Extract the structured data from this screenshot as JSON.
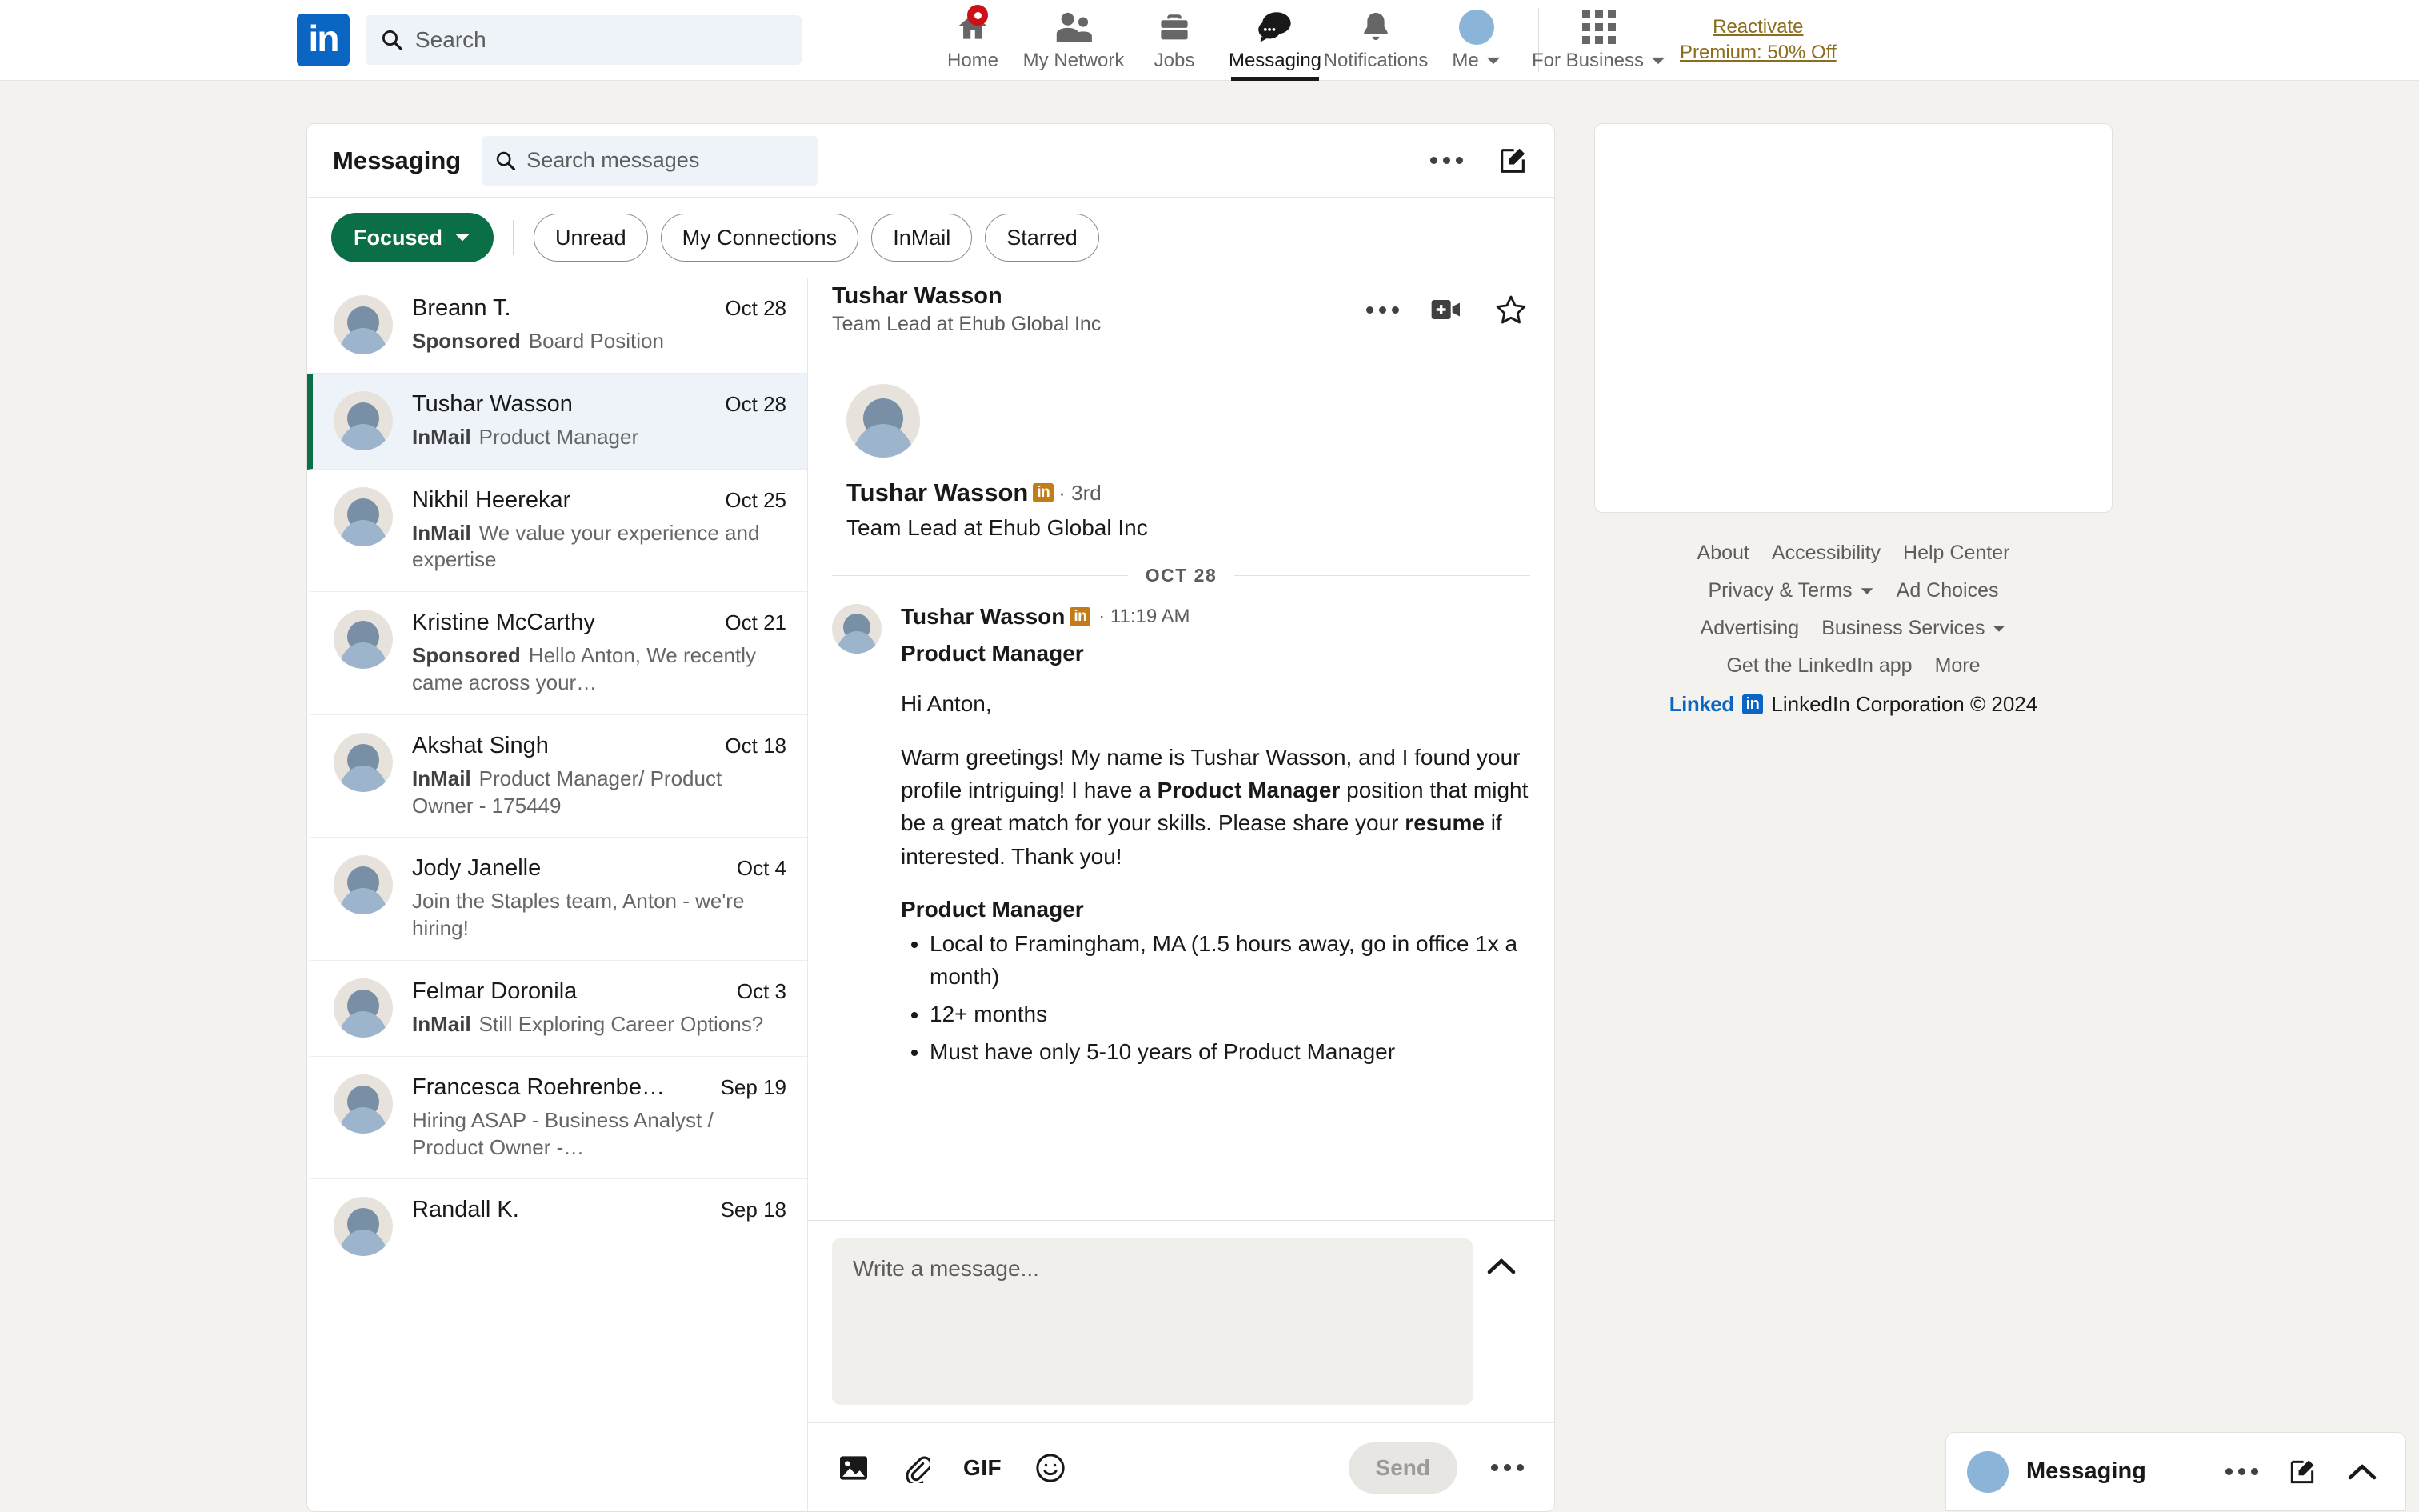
{
  "globalnav": {
    "logo": "in",
    "search": {
      "placeholder": "Search",
      "icon": "search-icon"
    },
    "items": [
      {
        "label": "Home",
        "icon": "home-icon",
        "active": false,
        "badge": true
      },
      {
        "label": "My Network",
        "icon": "people-icon",
        "active": false,
        "badge": false
      },
      {
        "label": "Jobs",
        "icon": "briefcase-icon",
        "active": false,
        "badge": false
      },
      {
        "label": "Messaging",
        "icon": "message-bubble-icon",
        "active": true,
        "badge": false
      },
      {
        "label": "Notifications",
        "icon": "bell-icon",
        "active": false,
        "badge": false
      },
      {
        "label": "Me",
        "icon": "avatar-icon",
        "active": false,
        "badge": false
      }
    ],
    "for_business": {
      "label": "For Business",
      "icon": "grid-apps-icon"
    },
    "premium": {
      "line1": "Reactivate",
      "line2": "Premium: 50% Off",
      "color": "#8a6d1e"
    }
  },
  "messaging": {
    "title": "Messaging",
    "search": {
      "placeholder": "Search messages",
      "icon": "search-icon"
    },
    "header_actions": [
      {
        "name": "more-options-icon",
        "glyph": "···"
      },
      {
        "name": "compose-message-icon",
        "glyph": "✎"
      }
    ],
    "filters": {
      "focused": {
        "label": "Focused",
        "color": "#0a6e46"
      },
      "pills": [
        "Unread",
        "My Connections",
        "InMail",
        "Starred"
      ]
    },
    "conversations": [
      {
        "name": "Breann T.",
        "date": "Oct 28",
        "tag": "Sponsored",
        "preview": "Board Position",
        "selected": false
      },
      {
        "name": "Tushar Wasson",
        "date": "Oct 28",
        "tag": "InMail",
        "preview": "Product Manager",
        "selected": true
      },
      {
        "name": "Nikhil Heerekar",
        "date": "Oct 25",
        "tag": "InMail",
        "preview": "We value your experience and expertise",
        "selected": false
      },
      {
        "name": "Kristine McCarthy",
        "date": "Oct 21",
        "tag": "Sponsored",
        "preview": "Hello Anton, We recently came across your…",
        "selected": false
      },
      {
        "name": "Akshat Singh",
        "date": "Oct 18",
        "tag": "InMail",
        "preview": "Product Manager/ Product Owner - 175449",
        "selected": false
      },
      {
        "name": "Jody Janelle",
        "date": "Oct 4",
        "tag": "",
        "preview": "Join the Staples team, Anton - we're hiring!",
        "selected": false
      },
      {
        "name": "Felmar Doronila",
        "date": "Oct 3",
        "tag": "InMail",
        "preview": "Still Exploring Career Options?",
        "selected": false
      },
      {
        "name": "Francesca Roehrenbe…",
        "date": "Sep 19",
        "tag": "",
        "preview": "Hiring ASAP - Business Analyst / Product Owner -…",
        "selected": false
      },
      {
        "name": "Randall K.",
        "date": "Sep 18",
        "tag": "",
        "preview": "",
        "selected": false
      }
    ],
    "thread": {
      "header": {
        "name": "Tushar Wasson",
        "subtitle": "Team Lead at Ehub Global Inc",
        "actions": [
          {
            "name": "more-options-icon"
          },
          {
            "name": "video-call-icon"
          },
          {
            "name": "star-icon"
          }
        ]
      },
      "profile": {
        "name": "Tushar Wasson",
        "badge": "in",
        "degree": "· 3rd",
        "role": "Team Lead at Ehub Global Inc"
      },
      "date_divider": "OCT 28",
      "message": {
        "sender": "Tushar Wasson",
        "badge": "in",
        "time": "· 11:19 AM",
        "subject": "Product Manager",
        "greeting": "Hi Anton,",
        "paragraph_pre": "Warm greetings! My name is Tushar Wasson, and I found your profile intriguing! I have a ",
        "paragraph_bold1": "Product Manager",
        "paragraph_mid": " position that might be a great match for your skills. Please share your ",
        "paragraph_bold2": "resume",
        "paragraph_post": " if interested. Thank you!",
        "list_heading": "Product Manager",
        "bullets": [
          "Local to Framingham, MA (1.5 hours away, go in office 1x a month)",
          "12+ months",
          "Must have only 5-10 years of Product Manager"
        ]
      },
      "composer": {
        "placeholder": "Write a message...",
        "expand_icon": "chevron-up-icon",
        "tools": [
          {
            "name": "image-icon",
            "label": ""
          },
          {
            "name": "attachment-icon",
            "label": ""
          },
          {
            "name": "gif-icon",
            "label": "GIF"
          },
          {
            "name": "emoji-icon",
            "label": ""
          }
        ],
        "send_label": "Send",
        "more_icon": "more-options-icon"
      }
    }
  },
  "rail": {
    "ad_card": "",
    "footer_rows": [
      [
        {
          "label": "About",
          "dropdown": false
        },
        {
          "label": "Accessibility",
          "dropdown": false
        },
        {
          "label": "Help Center",
          "dropdown": false
        }
      ],
      [
        {
          "label": "Privacy & Terms",
          "dropdown": true
        },
        {
          "label": "Ad Choices",
          "dropdown": false
        }
      ],
      [
        {
          "label": "Advertising",
          "dropdown": false
        },
        {
          "label": "Business Services",
          "dropdown": true
        }
      ],
      [
        {
          "label": "Get the LinkedIn app",
          "dropdown": false
        },
        {
          "label": "More",
          "dropdown": false
        }
      ]
    ],
    "copyright": {
      "brand": "Linked",
      "brand_mark": "in",
      "text": "LinkedIn Corporation © 2024"
    }
  },
  "overlay": {
    "title": "Messaging",
    "actions": [
      {
        "name": "more-options-icon"
      },
      {
        "name": "compose-message-icon"
      },
      {
        "name": "chevron-up-icon"
      }
    ]
  }
}
